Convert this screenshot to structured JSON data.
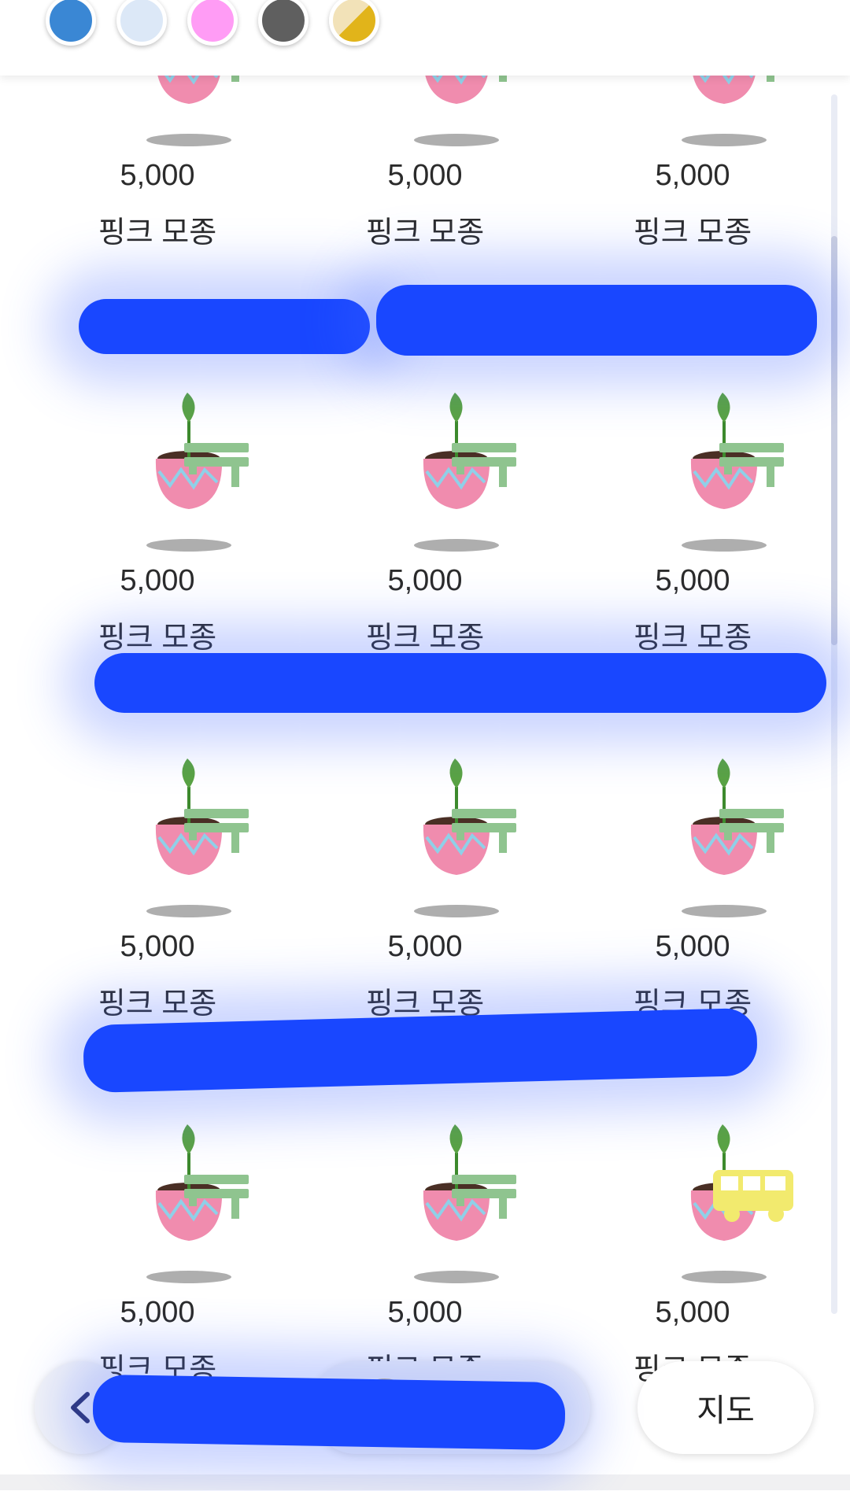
{
  "colors": {
    "swatches": [
      "#3a87d4",
      "#dce8f7",
      "#ff9cf5",
      "#5f5f5f",
      "split-beige-gold"
    ],
    "accent_scribble": "#1947ff",
    "pot": "#f08cae",
    "leaf": "#5aa342",
    "bench": "#8fc48f",
    "bus": "#f2ea6e"
  },
  "swatch_names": [
    "blue",
    "light-blue",
    "pink",
    "gray",
    "beige-gold"
  ],
  "grid": {
    "rows": [
      [
        {
          "price": "5,000",
          "name": "핑크 모종",
          "addr": "",
          "icon": "bench-icon"
        },
        {
          "price": "5,000",
          "name": "핑크 모종",
          "addr": "",
          "icon": "bench-icon"
        },
        {
          "price": "5,000",
          "name": "핑크 모종",
          "addr": "",
          "icon": "bench-icon"
        }
      ],
      [
        {
          "price": "5,000",
          "name": "핑크 모종",
          "addr": "",
          "icon": "bench-icon"
        },
        {
          "price": "5,000",
          "name": "핑크 모종",
          "addr": "",
          "icon": "bench-icon"
        },
        {
          "price": "5,000",
          "name": "핑크 모종",
          "addr": "",
          "icon": "bench-icon"
        }
      ],
      [
        {
          "price": "5,000",
          "name": "핑크 모종",
          "addr": "",
          "icon": "bench-icon"
        },
        {
          "price": "5,000",
          "name": "핑크 모종",
          "addr": "",
          "icon": "bench-icon"
        },
        {
          "price": "5,000",
          "name": "핑크 모종",
          "addr": "",
          "icon": "bench-icon"
        }
      ],
      [
        {
          "price": "5,000",
          "name": "핑크 모종",
          "addr": "",
          "icon": "bench-icon"
        },
        {
          "price": "5,000",
          "name": "핑크 모종",
          "addr": "",
          "icon": "bench-icon"
        },
        {
          "price": "5,000",
          "name": "핑크 모종",
          "addr": "",
          "icon": "bus-icon"
        }
      ]
    ]
  },
  "bottom": {
    "back_icon": "chevron-left-icon",
    "mid_label": "",
    "map_label": "지도"
  }
}
